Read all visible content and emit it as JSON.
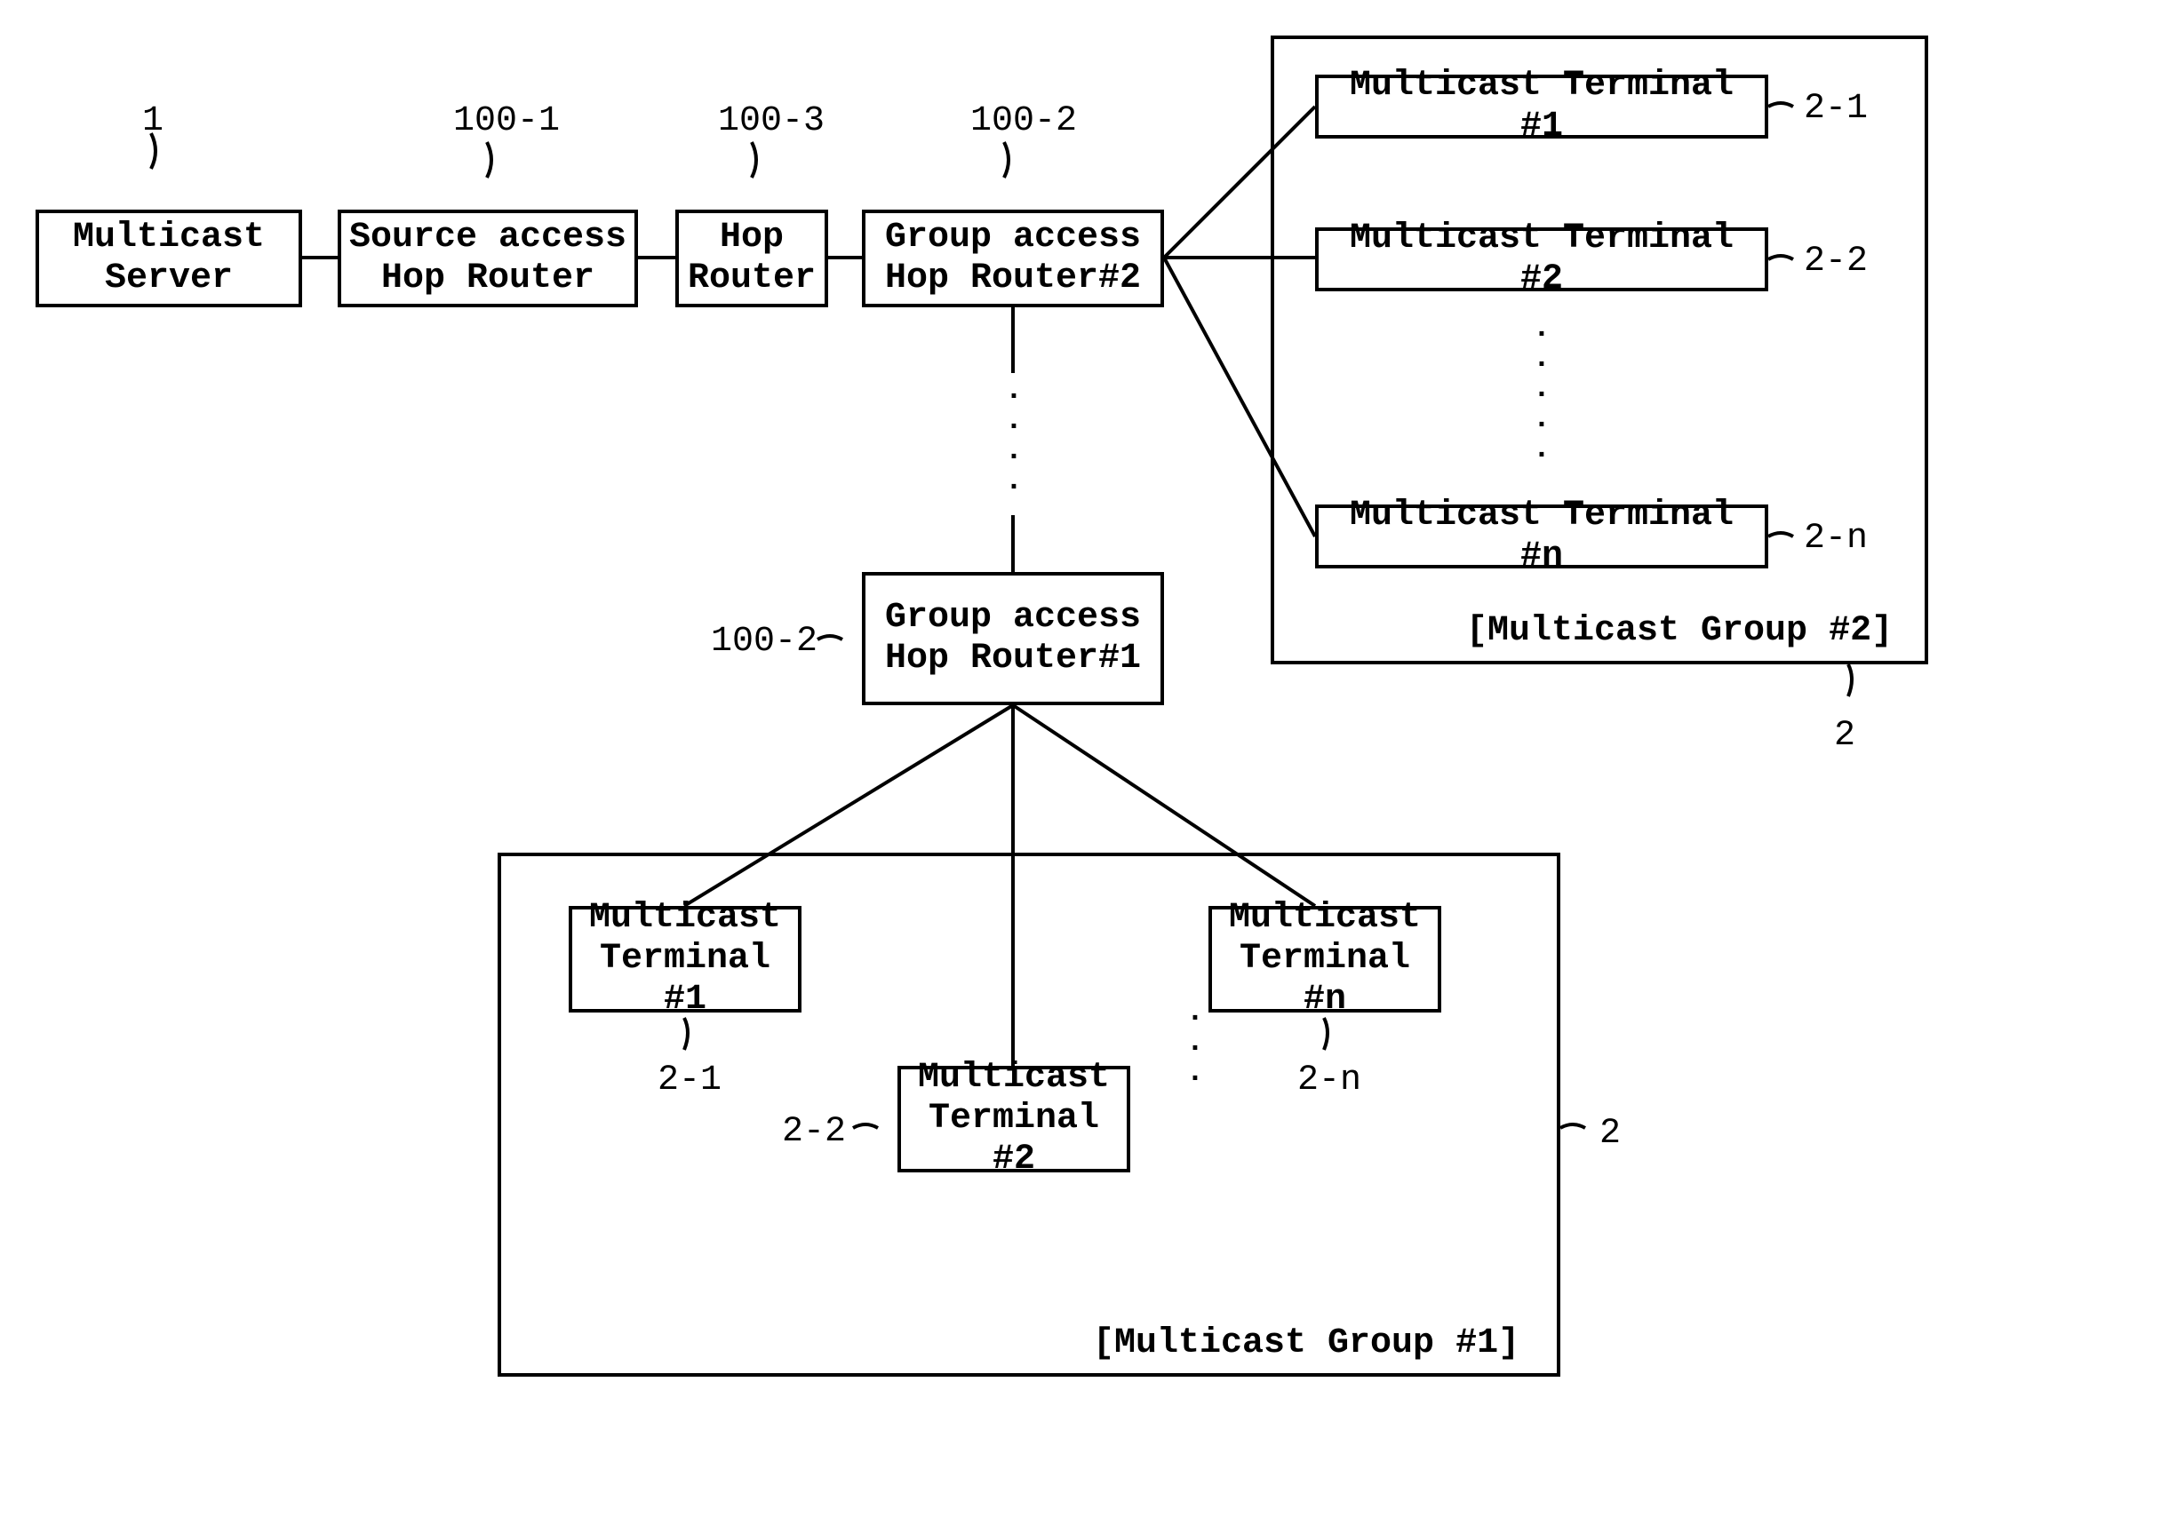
{
  "topRow": {
    "server": {
      "text": "Multicast\nServer",
      "ref": "1"
    },
    "source": {
      "text": "Source access\nHop Router",
      "ref": "100-1"
    },
    "hop": {
      "text": "Hop\nRouter",
      "ref": "100-3"
    },
    "group2r": {
      "text": "Group access\nHop Router#2",
      "ref": "100-2"
    }
  },
  "group1r": {
    "text": "Group access\nHop Router#1",
    "ref": "100-2"
  },
  "group2": {
    "label": "[Multicast Group #2]",
    "ref": "2",
    "t1": {
      "text": "Multicast Terminal #1",
      "ref": "2-1"
    },
    "t2": {
      "text": "Multicast Terminal #2",
      "ref": "2-2"
    },
    "tn": {
      "text": "Multicast Terminal #n",
      "ref": "2-n"
    }
  },
  "group1": {
    "label": "[Multicast Group #1]",
    "ref": "2",
    "t1": {
      "text": "Multicast\nTerminal #1",
      "ref": "2-1"
    },
    "t2": {
      "text": "Multicast\nTerminal #2",
      "ref": "2-2"
    },
    "tn": {
      "text": "Multicast\nTerminal #n",
      "ref": "2-n"
    }
  }
}
